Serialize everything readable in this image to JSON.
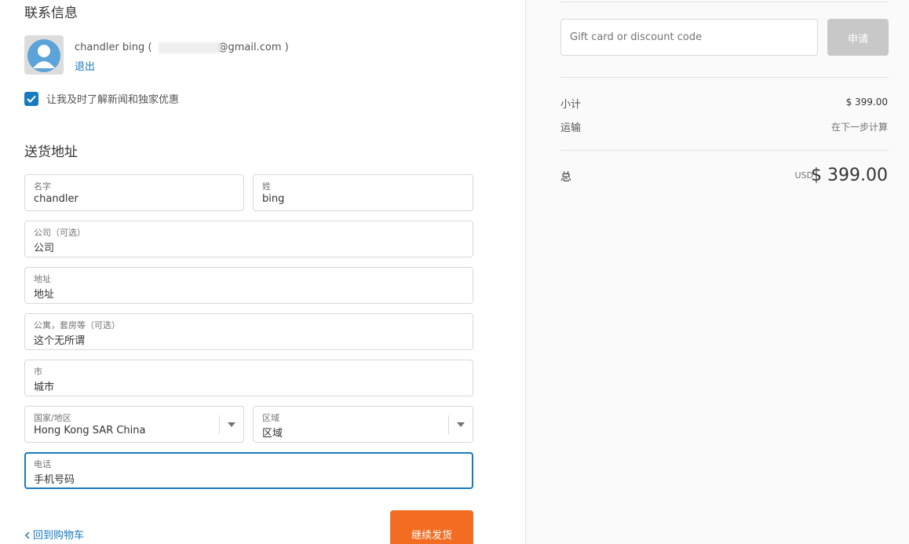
{
  "contact": {
    "title": "联系信息",
    "name": "chandler bing",
    "paren_open": "(",
    "email_visible": "@gmail.com",
    "paren_close": ")",
    "logout": "退出",
    "newsletter_label": "让我及时了解新闻和独家优惠",
    "newsletter_checked": true
  },
  "shipping": {
    "title": "送货地址",
    "first_name": {
      "label": "名字",
      "value": "chandler"
    },
    "last_name": {
      "label": "姓",
      "value": "bing"
    },
    "company": {
      "label": "公司（可选）",
      "value": "公司"
    },
    "address": {
      "label": "地址",
      "value": "地址"
    },
    "apartment": {
      "label": "公寓，套房等（可选）",
      "value": "这个无所谓"
    },
    "city": {
      "label": "市",
      "value": "城市"
    },
    "country": {
      "label": "国家/地区",
      "value": "Hong Kong SAR China"
    },
    "region": {
      "label": "区域",
      "value": "区域"
    },
    "phone": {
      "label": "电话",
      "value": "手机号码"
    }
  },
  "footer": {
    "back_label": "回到购物车",
    "continue_label": "继续发货"
  },
  "summary": {
    "gift_placeholder": "Gift card or discount code",
    "apply_label": "申请",
    "subtotal_label": "小计",
    "subtotal_value": "$ 399.00",
    "shipping_label": "运输",
    "shipping_value": "在下一步计算",
    "total_label": "总",
    "total_currency": "USD",
    "total_value": "$ 399.00"
  },
  "colors": {
    "accent": "#197bbd",
    "button": "#f26d21",
    "apply_disabled": "#c8c8c8"
  }
}
